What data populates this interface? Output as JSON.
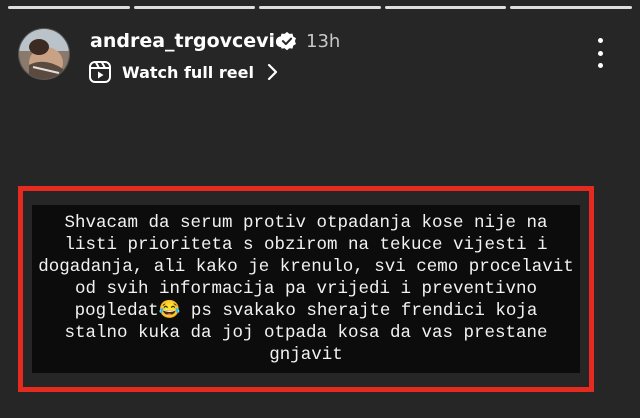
{
  "header": {
    "username": "andrea_trgovcevic",
    "time_ago": "13h",
    "verified_icon": "verified-badge-icon",
    "more_icon": "more-vertical-icon"
  },
  "reel_link": {
    "label": "Watch full reel",
    "icon": "reel-icon",
    "chevron": "chevron-right-icon"
  },
  "progress": {
    "segments": 5
  },
  "caption": {
    "text": "Shvacam da serum protiv otpadanja kose nije na listi prioriteta s obzirom na tekuce vijesti i dogadanja, ali kako je krenulo, svi cemo procelavit od svih informacija pa vrijedi i preventivno pogledat😂 ps svakako sherajte frendici koja stalno kuka da joj otpada kosa da vas prestane gnjavit"
  },
  "colors": {
    "background": "#262626",
    "highlight_border": "#e52b1f",
    "caption_background": "#0c0c0c"
  }
}
